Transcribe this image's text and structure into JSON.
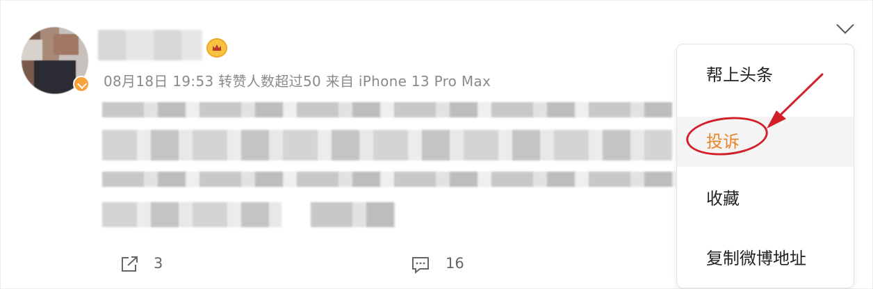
{
  "post": {
    "meta_text": "08月18日 19:53 转赞人数超过50  来自 iPhone 13 Pro Max",
    "share_count": "3",
    "comment_count": "16"
  },
  "menu": {
    "items": [
      {
        "label": "帮上头条"
      },
      {
        "label": "投诉"
      },
      {
        "label": "收藏"
      },
      {
        "label": "复制微博地址"
      }
    ]
  },
  "colors": {
    "report_text": "#e8862a",
    "annotation_red": "#d2202a",
    "vip_badge": "#f7a13b"
  },
  "icons": [
    "crown-icon",
    "verified-badge-icon",
    "chevron-down-icon",
    "share-icon",
    "comment-icon",
    "red-arrow-annotation"
  ]
}
